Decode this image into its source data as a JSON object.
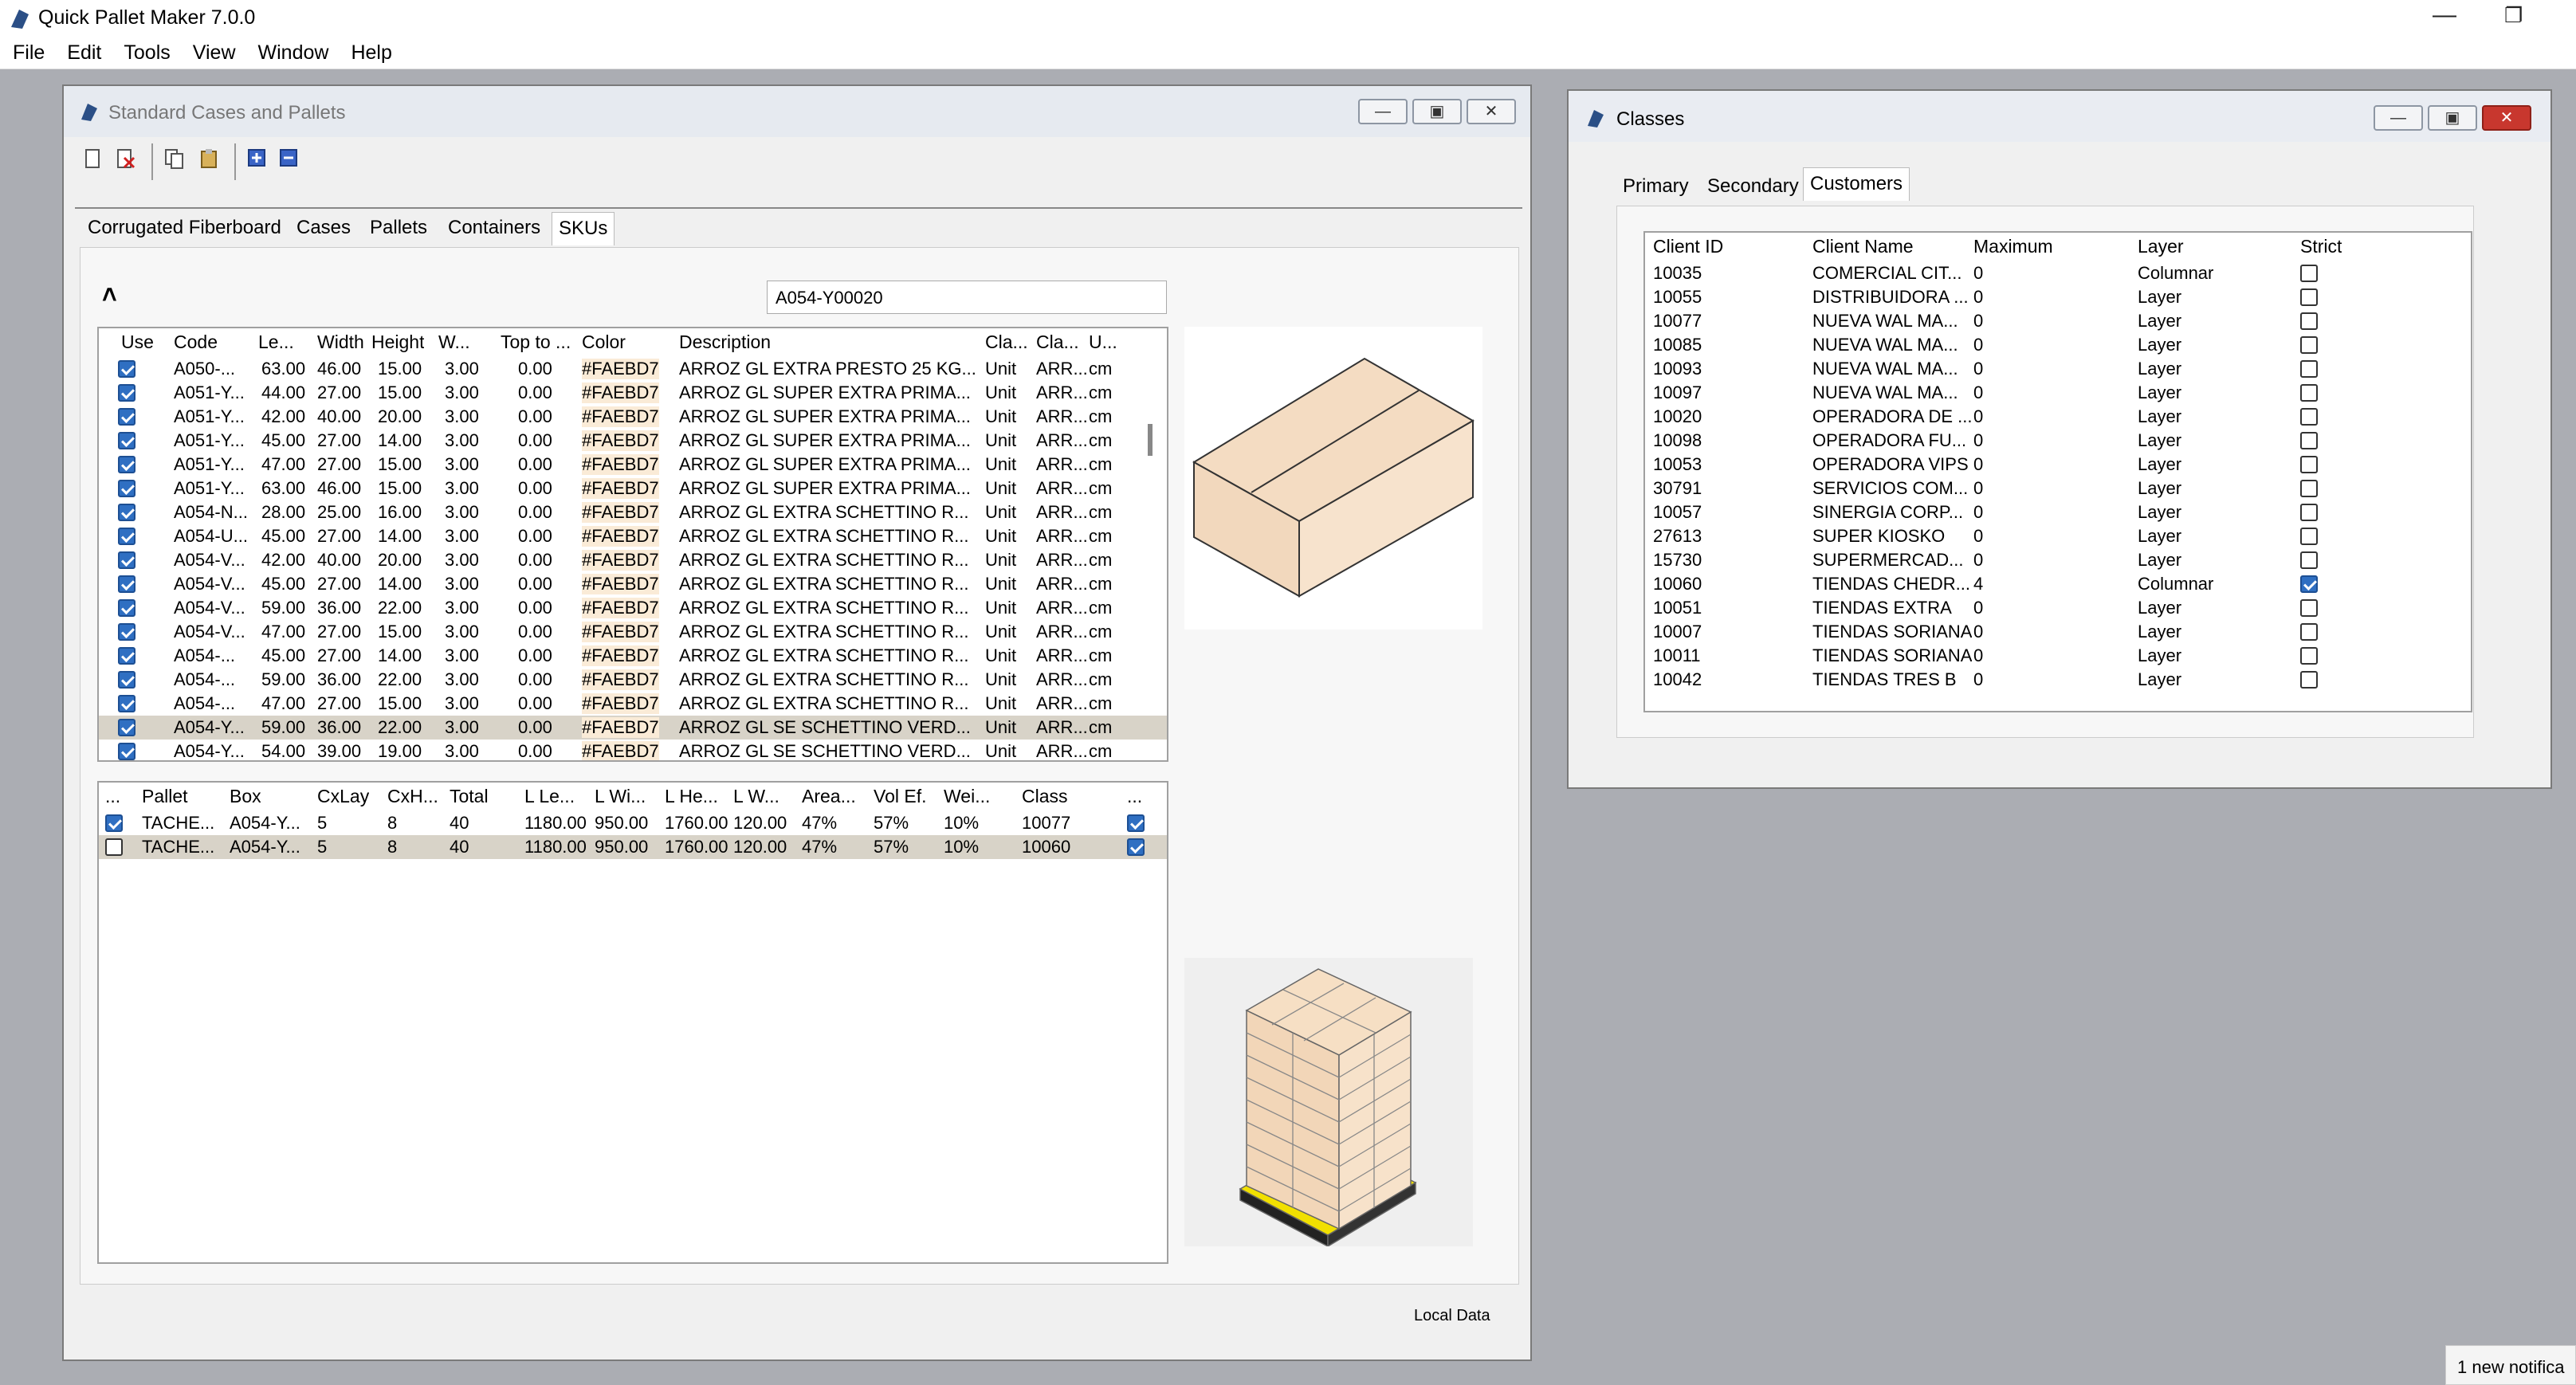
{
  "app": {
    "title": "Quick Pallet Maker 7.0.0"
  },
  "menu": [
    "File",
    "Edit",
    "Tools",
    "View",
    "Window",
    "Help"
  ],
  "std_window": {
    "title": "Standard Cases and Pallets",
    "tabs": [
      "Corrugated Fiberboard",
      "Cases",
      "Pallets",
      "Containers",
      "SKUs"
    ],
    "active_tab": "SKUs",
    "search_value": "A054-Y00020",
    "collapse_glyph": "˄",
    "footer": "Local Data",
    "sku_headers": [
      "Use",
      "Code",
      "Le...",
      "Width",
      "Height",
      "W...",
      "Top to ...",
      "Color",
      "Description",
      "Cla...",
      "Cla...",
      "U..."
    ],
    "sku_rows": [
      [
        "A050-...",
        "63.00",
        "46.00",
        "15.00",
        "3.00",
        "0.00",
        "#FAEBD7",
        "ARROZ GL EXTRA PRESTO 25 KG...",
        "Unit",
        "ARR...",
        "cm"
      ],
      [
        "A051-Y...",
        "44.00",
        "27.00",
        "15.00",
        "3.00",
        "0.00",
        "#FAEBD7",
        "ARROZ GL SUPER EXTRA PRIMA...",
        "Unit",
        "ARR...",
        "cm"
      ],
      [
        "A051-Y...",
        "42.00",
        "40.00",
        "20.00",
        "3.00",
        "0.00",
        "#FAEBD7",
        "ARROZ GL SUPER EXTRA PRIMA...",
        "Unit",
        "ARR...",
        "cm"
      ],
      [
        "A051-Y...",
        "45.00",
        "27.00",
        "14.00",
        "3.00",
        "0.00",
        "#FAEBD7",
        "ARROZ GL SUPER EXTRA PRIMA...",
        "Unit",
        "ARR...",
        "cm"
      ],
      [
        "A051-Y...",
        "47.00",
        "27.00",
        "15.00",
        "3.00",
        "0.00",
        "#FAEBD7",
        "ARROZ GL SUPER EXTRA PRIMA...",
        "Unit",
        "ARR...",
        "cm"
      ],
      [
        "A051-Y...",
        "63.00",
        "46.00",
        "15.00",
        "3.00",
        "0.00",
        "#FAEBD7",
        "ARROZ GL SUPER EXTRA PRIMA...",
        "Unit",
        "ARR...",
        "cm"
      ],
      [
        "A054-N...",
        "28.00",
        "25.00",
        "16.00",
        "3.00",
        "0.00",
        "#FAEBD7",
        "ARROZ GL EXTRA SCHETTINO R...",
        "Unit",
        "ARR...",
        "cm"
      ],
      [
        "A054-U...",
        "45.00",
        "27.00",
        "14.00",
        "3.00",
        "0.00",
        "#FAEBD7",
        "ARROZ GL EXTRA SCHETTINO R...",
        "Unit",
        "ARR...",
        "cm"
      ],
      [
        "A054-V...",
        "42.00",
        "40.00",
        "20.00",
        "3.00",
        "0.00",
        "#FAEBD7",
        "ARROZ GL EXTRA SCHETTINO R...",
        "Unit",
        "ARR...",
        "cm"
      ],
      [
        "A054-V...",
        "45.00",
        "27.00",
        "14.00",
        "3.00",
        "0.00",
        "#FAEBD7",
        "ARROZ GL EXTRA SCHETTINO R...",
        "Unit",
        "ARR...",
        "cm"
      ],
      [
        "A054-V...",
        "59.00",
        "36.00",
        "22.00",
        "3.00",
        "0.00",
        "#FAEBD7",
        "ARROZ GL EXTRA SCHETTINO R...",
        "Unit",
        "ARR...",
        "cm"
      ],
      [
        "A054-V...",
        "47.00",
        "27.00",
        "15.00",
        "3.00",
        "0.00",
        "#FAEBD7",
        "ARROZ GL EXTRA SCHETTINO R...",
        "Unit",
        "ARR...",
        "cm"
      ],
      [
        "A054-...",
        "45.00",
        "27.00",
        "14.00",
        "3.00",
        "0.00",
        "#FAEBD7",
        "ARROZ GL EXTRA SCHETTINO R...",
        "Unit",
        "ARR...",
        "cm"
      ],
      [
        "A054-...",
        "59.00",
        "36.00",
        "22.00",
        "3.00",
        "0.00",
        "#FAEBD7",
        "ARROZ GL EXTRA SCHETTINO R...",
        "Unit",
        "ARR...",
        "cm"
      ],
      [
        "A054-...",
        "47.00",
        "27.00",
        "15.00",
        "3.00",
        "0.00",
        "#FAEBD7",
        "ARROZ GL EXTRA SCHETTINO R...",
        "Unit",
        "ARR...",
        "cm"
      ],
      [
        "A054-Y...",
        "59.00",
        "36.00",
        "22.00",
        "3.00",
        "0.00",
        "#FAEBD7",
        "ARROZ GL SE SCHETTINO VERD...",
        "Unit",
        "ARR...",
        "cm"
      ],
      [
        "A054-Y...",
        "54.00",
        "39.00",
        "19.00",
        "3.00",
        "0.00",
        "#FAEBD7",
        "ARROZ GL SE SCHETTINO VERD...",
        "Unit",
        "ARR...",
        "cm"
      ]
    ],
    "sku_selected_index": 15,
    "pallet_headers": [
      "...",
      "Pallet",
      "Box",
      "CxLay",
      "CxH...",
      "Total",
      "L Le...",
      "L Wi...",
      "L He...",
      "L W...",
      "Area...",
      "Vol Ef.",
      "Wei...",
      "Class",
      "..."
    ],
    "pallet_rows": [
      {
        "checked": true,
        "cells": [
          "TACHE...",
          "A054-Y...",
          "5",
          "8",
          "40",
          "1180.00",
          "950.00",
          "1760.00",
          "120.00",
          "47%",
          "57%",
          "10%",
          "10077"
        ],
        "end_checked": true
      },
      {
        "checked": false,
        "cells": [
          "TACHE...",
          "A054-Y...",
          "5",
          "8",
          "40",
          "1180.00",
          "950.00",
          "1760.00",
          "120.00",
          "47%",
          "57%",
          "10%",
          "10060"
        ],
        "end_checked": true
      }
    ]
  },
  "classes_window": {
    "title": "Classes",
    "tabs": [
      "Primary",
      "Secondary",
      "Customers"
    ],
    "active_tab": "Customers",
    "headers": [
      "Client ID",
      "Client Name",
      "Maximum",
      "Layer",
      "Strict"
    ],
    "rows": [
      [
        "10035",
        "COMERCIAL CIT...",
        "0",
        "Columnar",
        false
      ],
      [
        "10055",
        "DISTRIBUIDORA ...",
        "0",
        "Layer",
        false
      ],
      [
        "10077",
        "NUEVA WAL MA...",
        "0",
        "Layer",
        false
      ],
      [
        "10085",
        "NUEVA WAL MA...",
        "0",
        "Layer",
        false
      ],
      [
        "10093",
        "NUEVA WAL MA...",
        "0",
        "Layer",
        false
      ],
      [
        "10097",
        "NUEVA WAL MA...",
        "0",
        "Layer",
        false
      ],
      [
        "10020",
        "OPERADORA DE ...",
        "0",
        "Layer",
        false
      ],
      [
        "10098",
        "OPERADORA FU...",
        "0",
        "Layer",
        false
      ],
      [
        "10053",
        "OPERADORA VIPS",
        "0",
        "Layer",
        false
      ],
      [
        "30791",
        "SERVICIOS COM...",
        "0",
        "Layer",
        false
      ],
      [
        "10057",
        "SINERGIA CORP...",
        "0",
        "Layer",
        false
      ],
      [
        "27613",
        "SUPER KIOSKO",
        "0",
        "Layer",
        false
      ],
      [
        "15730",
        "SUPERMERCAD...",
        "0",
        "Layer",
        false
      ],
      [
        "10060",
        "TIENDAS CHEDR...",
        "4",
        "Columnar",
        true
      ],
      [
        "10051",
        "TIENDAS EXTRA",
        "0",
        "Layer",
        false
      ],
      [
        "10007",
        "TIENDAS SORIANA",
        "0",
        "Layer",
        false
      ],
      [
        "10011",
        "TIENDAS SORIANA",
        "0",
        "Layer",
        false
      ],
      [
        "10042",
        "TIENDAS TRES B",
        "0",
        "Layer",
        false
      ]
    ]
  },
  "notification": "1 new notifica",
  "colors": {
    "box_face": "#FAEBD7",
    "checkbox_on": "#2f6fc2",
    "selected_row": "#d8d3c8",
    "pallet_yellow": "#f2e400"
  }
}
